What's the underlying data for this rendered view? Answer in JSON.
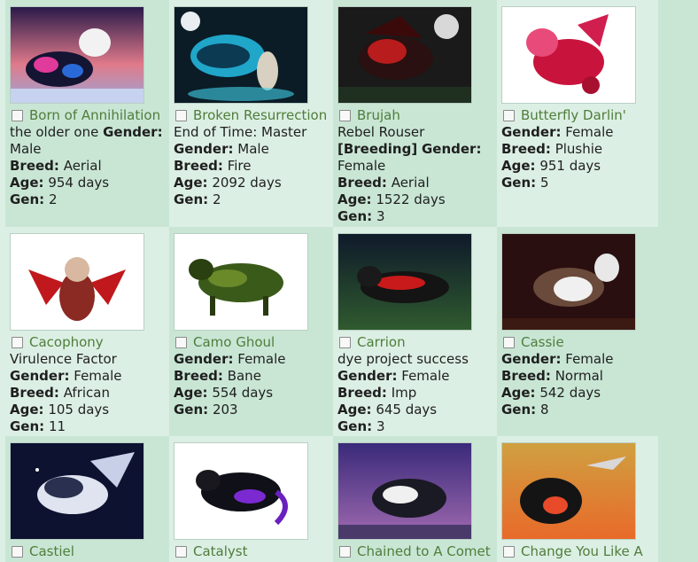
{
  "pets": [
    {
      "name": "Born of Annihilation",
      "desc": "the older one",
      "gender": "Male",
      "breed": "Aerial",
      "age": "954 days",
      "gen": "2",
      "image": "dark wolf with blue pink markings and white owl"
    },
    {
      "name": "Broken Resurrection",
      "desc": "End of Time: Master",
      "gender": "Male",
      "breed": "Fire",
      "age": "2092 days",
      "gen": "2",
      "image": "blue glowing spectral wolf with skeleton"
    },
    {
      "name": "Brujah",
      "desc": "Rebel Rouser",
      "desc_bold": "[Breeding]",
      "gender": "Female",
      "breed": "Aerial",
      "age": "1522 days",
      "gen": "3",
      "image": "red black winged wolf under moon"
    },
    {
      "name": "Butterfly Darlin'",
      "desc": "",
      "gender": "Female",
      "breed": "Plushie",
      "age": "951 days",
      "gen": "5",
      "image": "pink plush wolf with wings"
    },
    {
      "name": "Cacophony",
      "desc": "Virulence Factor",
      "gender": "Female",
      "breed": "African",
      "age": "105 days",
      "gen": "11",
      "image": "red winged african wild dog"
    },
    {
      "name": "Camo Ghoul",
      "desc": "",
      "gender": "Female",
      "breed": "Bane",
      "age": "554 days",
      "gen": "203",
      "image": "green camo wolf"
    },
    {
      "name": "Carrion",
      "desc": "dye project success",
      "gender": "Female",
      "breed": "Imp",
      "age": "645 days",
      "gen": "3",
      "image": "black red cat creature at night"
    },
    {
      "name": "Cassie",
      "desc": "",
      "gender": "Female",
      "breed": "Normal",
      "age": "542 days",
      "gen": "8",
      "image": "brown white husky"
    },
    {
      "name": "Castiel",
      "desc": "",
      "gender": "",
      "breed": "",
      "age": "",
      "gen": "",
      "image": "silver winged wolf in space"
    },
    {
      "name": "Catalyst",
      "desc": "",
      "gender": "",
      "breed": "",
      "age": "",
      "gen": "",
      "image": "black purple wolf"
    },
    {
      "name": "Chained to A Comet",
      "desc": "",
      "gender": "",
      "breed": "",
      "age": "",
      "gen": "",
      "image": "black white wolf purple sky"
    },
    {
      "name": "Change You Like A",
      "desc": "",
      "gender": "",
      "breed": "",
      "age": "",
      "gen": "",
      "image": "rainbow black wolf sunset with airplane"
    }
  ],
  "labels": {
    "gender": "Gender:",
    "breed": "Breed:",
    "age": "Age:",
    "gen": "Gen:"
  }
}
